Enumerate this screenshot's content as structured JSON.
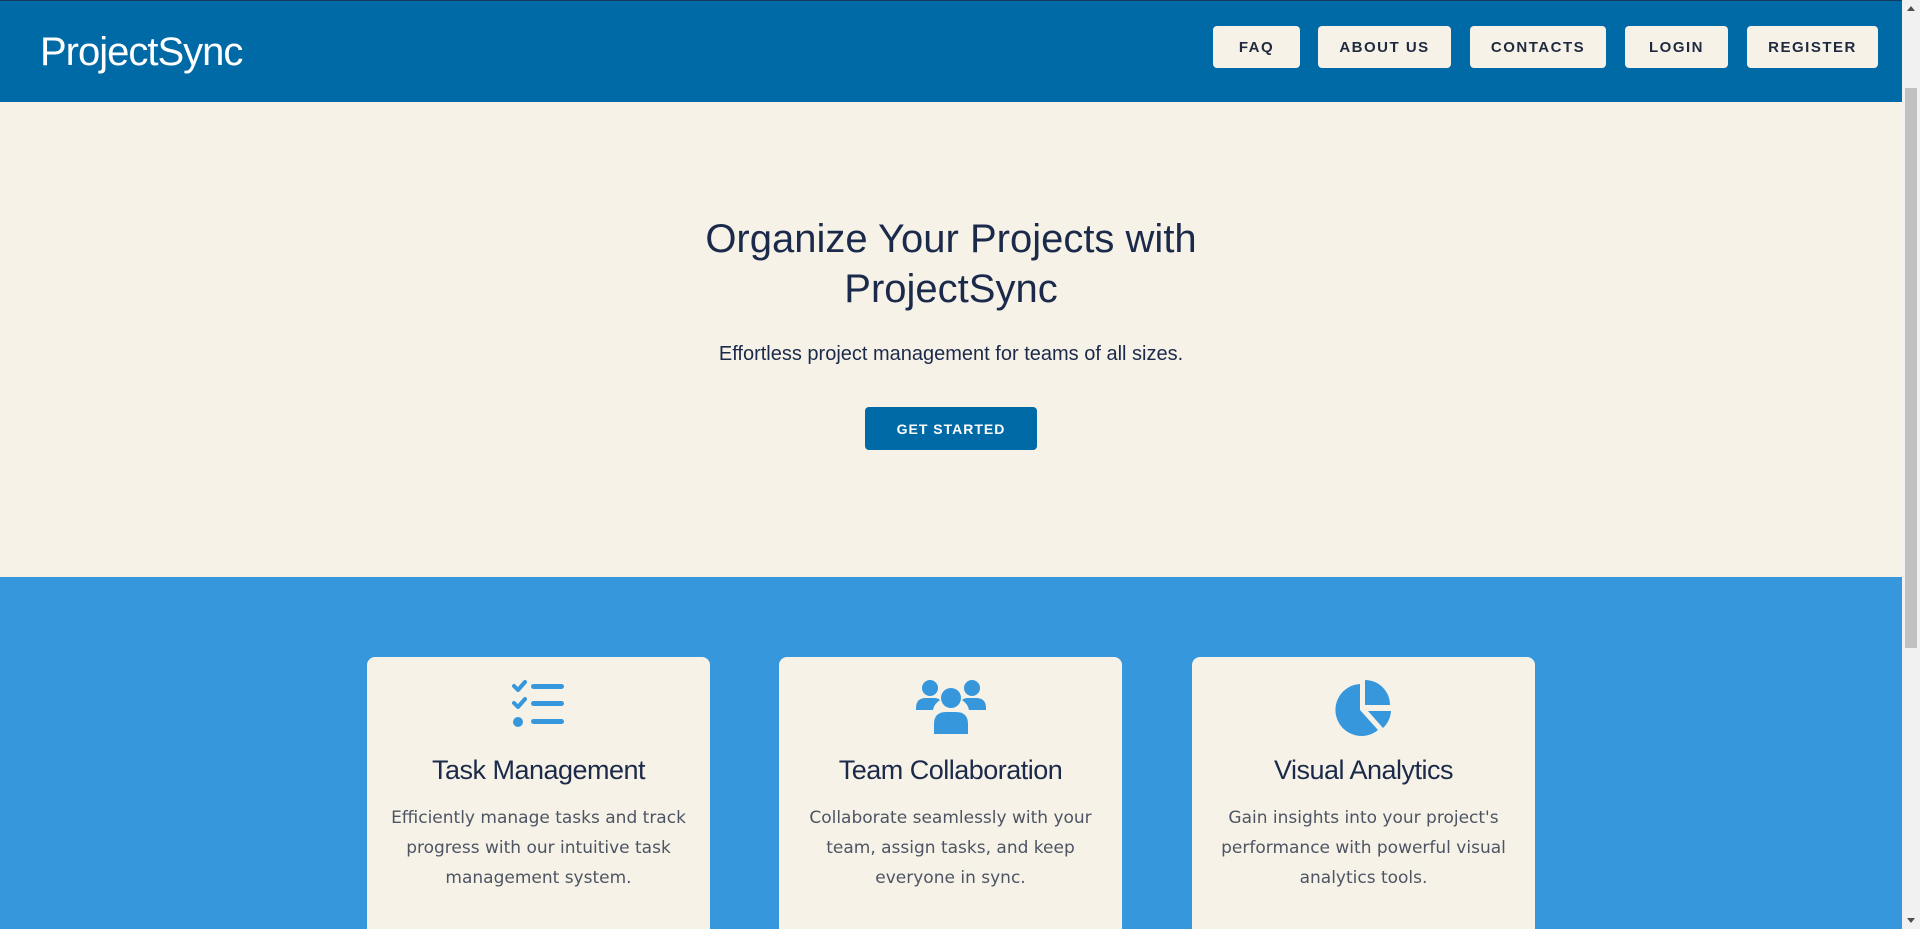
{
  "brand": {
    "name": "ProjectSync"
  },
  "nav": {
    "items": [
      {
        "label": "FAQ"
      },
      {
        "label": "ABOUT US"
      },
      {
        "label": "CONTACTS"
      },
      {
        "label": "LOGIN"
      },
      {
        "label": "REGISTER"
      }
    ]
  },
  "hero": {
    "title": "Organize Your Projects with ProjectSync",
    "subtitle": "Effortless project management for teams of all sizes.",
    "cta_label": "GET STARTED"
  },
  "features": [
    {
      "icon": "task-list-icon",
      "title": "Task Management",
      "description": "Efficiently manage tasks and track progress with our intuitive task management system."
    },
    {
      "icon": "users-group-icon",
      "title": "Team Collaboration",
      "description": "Collaborate seamlessly with your team, assign tasks, and keep everyone in sync."
    },
    {
      "icon": "pie-chart-icon",
      "title": "Visual Analytics",
      "description": "Gain insights into your project's performance with powerful visual analytics tools."
    }
  ],
  "colors": {
    "header_bg": "#006aa7",
    "cream": "#f6f2e8",
    "features_bg": "#3797dc",
    "text_dark": "#1b2a4a",
    "icon_blue": "#3797dc"
  }
}
